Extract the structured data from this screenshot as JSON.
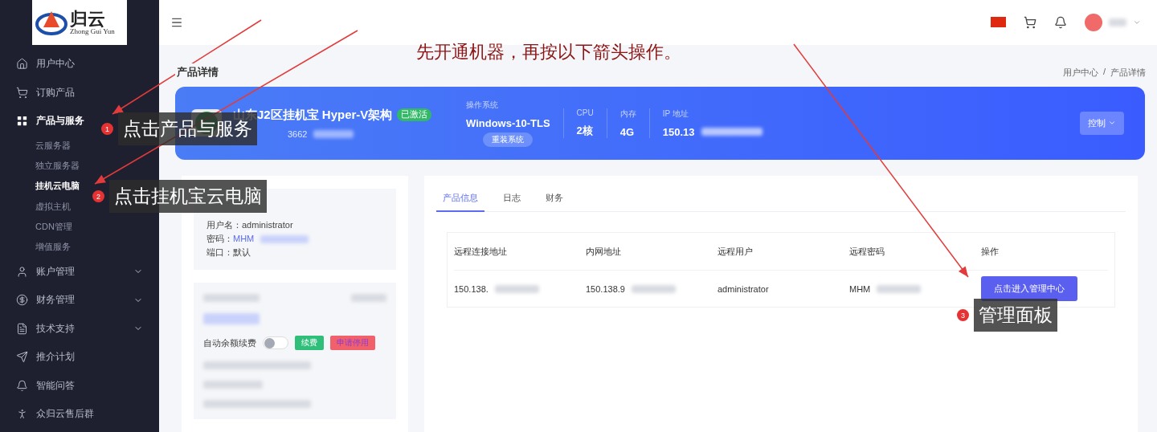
{
  "annotation": {
    "headline": "先开通机器，再按以下箭头操作。",
    "callouts": [
      {
        "number": "1",
        "text": "点击产品与服务"
      },
      {
        "number": "2",
        "text": "点击挂机宝云电脑"
      },
      {
        "number": "3",
        "text": "管理面板"
      }
    ]
  },
  "sidebar": {
    "logo": {
      "title": "归云",
      "subtitle": "Zhong Gui Yun"
    },
    "items": [
      {
        "label": "用户中心",
        "kind": "home"
      },
      {
        "label": "订购产品",
        "kind": "cart"
      },
      {
        "label": "产品与服务",
        "kind": "grid",
        "expanded": true,
        "children": [
          {
            "label": "云服务器",
            "selected": false
          },
          {
            "label": "独立服务器",
            "selected": false
          },
          {
            "label": "挂机云电脑",
            "selected": true
          },
          {
            "label": "虚拟主机",
            "selected": false
          },
          {
            "label": "CDN管理",
            "selected": false
          },
          {
            "label": "增值服务",
            "selected": false
          }
        ]
      },
      {
        "label": "账户管理",
        "kind": "user",
        "expanded": false
      },
      {
        "label": "财务管理",
        "kind": "dollar",
        "expanded": false
      },
      {
        "label": "技术支持",
        "kind": "doc",
        "expanded": false
      },
      {
        "label": "推介计划",
        "kind": "send"
      },
      {
        "label": "智能问答",
        "kind": "bell"
      },
      {
        "label": "众归云售后群",
        "kind": "run"
      }
    ]
  },
  "page": {
    "title": "产品详情",
    "breadcrumb": {
      "items": [
        "用户中心",
        "产品详情"
      ],
      "separator": "/"
    }
  },
  "banner": {
    "name": "山东J2区挂机宝 Hyper-V架构",
    "status": "已激活",
    "product_id": "3662",
    "specs": [
      {
        "label": "操作系统",
        "value": "Windows-10-TLS",
        "action": "重装系统"
      },
      {
        "label": "CPU",
        "value": "2核"
      },
      {
        "label": "内存",
        "value": "4G"
      },
      {
        "label": "IP 地址",
        "value": "150.13"
      }
    ],
    "control": "控制"
  },
  "login_info": {
    "lines": [
      {
        "label": "用户名：",
        "value": "administrator"
      },
      {
        "label": "密码：",
        "value": "MHM"
      },
      {
        "label": "端口：",
        "value": "默认"
      }
    ]
  },
  "renewal": {
    "label": "自动余额续费",
    "on": false,
    "renew": "续费",
    "stop": "申请停用"
  },
  "tabs": [
    {
      "label": "产品信息",
      "selected": true
    },
    {
      "label": "日志",
      "selected": false
    },
    {
      "label": "财务",
      "selected": false
    }
  ],
  "table": {
    "columns": [
      "远程连接地址",
      "内网地址",
      "远程用户",
      "远程密码",
      "操作"
    ],
    "rows": [
      {
        "cells": [
          "150.138.",
          "150.138.9",
          "administrator",
          "MHM"
        ],
        "action": "点击进入管理中心"
      }
    ]
  }
}
